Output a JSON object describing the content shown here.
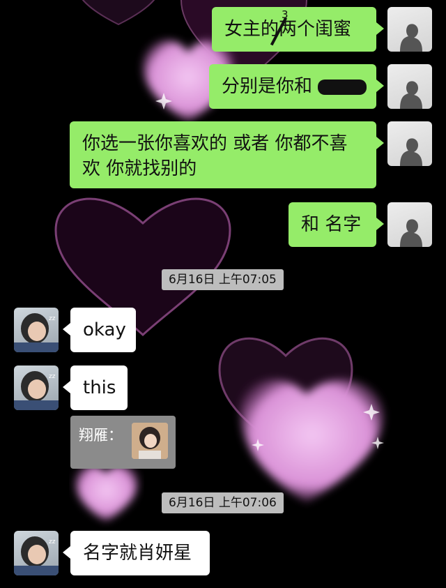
{
  "messages": {
    "m1": {
      "text_a": "女主的",
      "text_strike": "两",
      "text_b": "个闺蜜",
      "correction": "3"
    },
    "m2": {
      "text": "分别是你和"
    },
    "m3": {
      "line1": "你选一张你喜欢的 或者 你都不喜",
      "line2": "欢 你就找别的"
    },
    "m4": {
      "text": "和 名字"
    },
    "t1": {
      "text": "6月16日 上午07:05"
    },
    "m5": {
      "text": "okay"
    },
    "m6": {
      "text": "this"
    },
    "q1": {
      "label": "翔雁："
    },
    "t2": {
      "text": "6月16日 上午07:06"
    },
    "m7": {
      "text": "名字就肖妍星"
    }
  },
  "colors": {
    "self_bubble": "#95ec69",
    "other_bubble": "#ffffff",
    "background": "#000000",
    "timestamp_bg": "#bdbdbd"
  },
  "icons": [
    "self-avatar-icon",
    "friend-avatar-icon",
    "heart-decoration-icon"
  ]
}
